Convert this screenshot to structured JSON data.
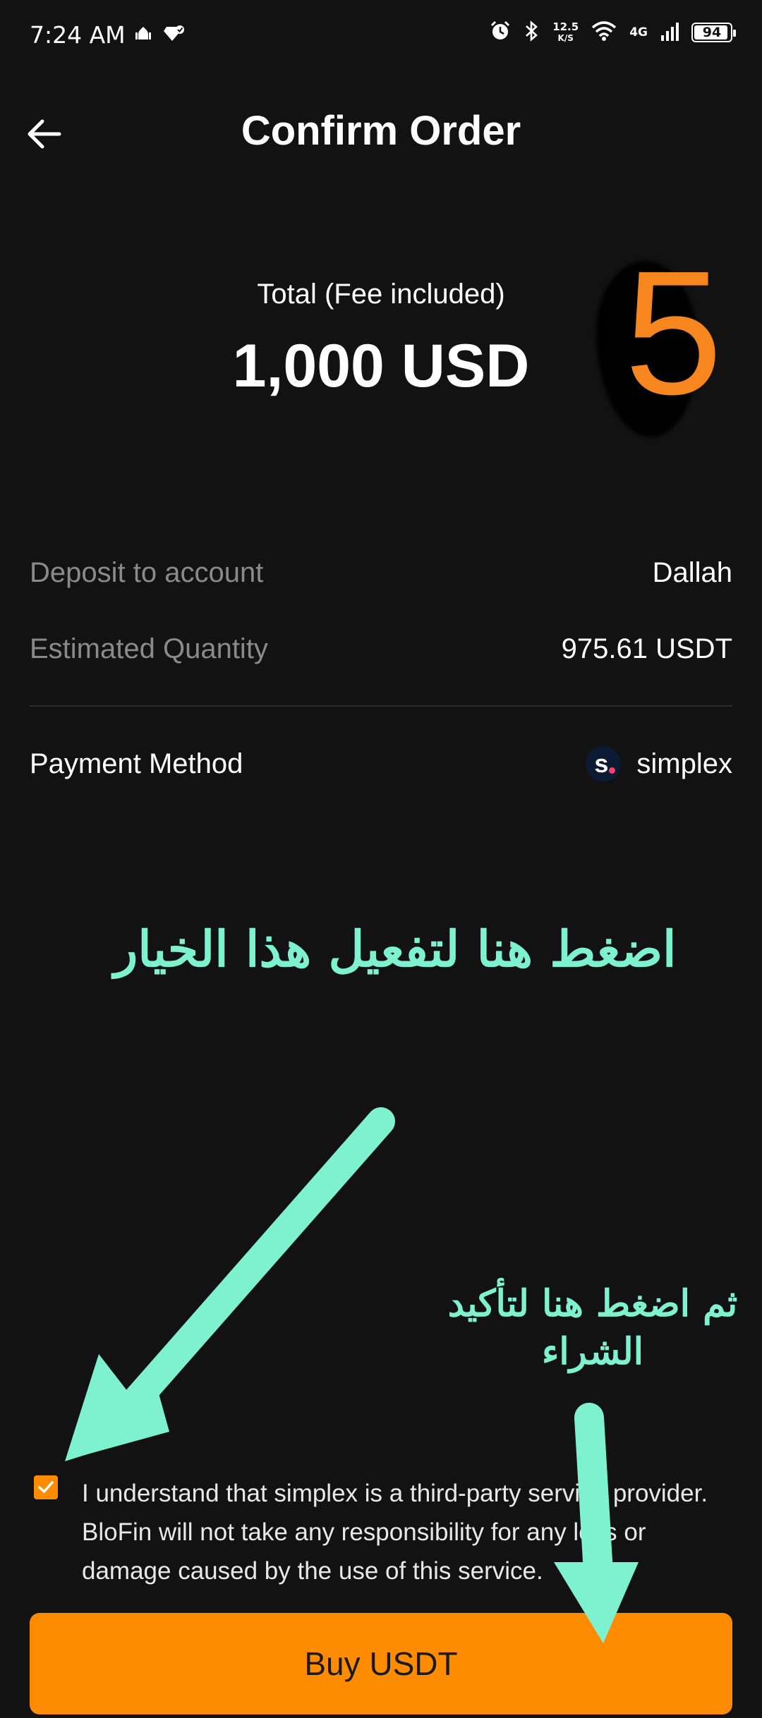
{
  "status_bar": {
    "time": "7:24 AM",
    "net_speed_value": "12.5",
    "net_speed_unit": "K/S",
    "network_type": "4G",
    "battery_percent": "94",
    "battery_level": 0.94
  },
  "header": {
    "title": "Confirm Order"
  },
  "summary": {
    "total_label": "Total (Fee included)",
    "total_amount": "1,000 USD"
  },
  "step_badge": {
    "number": "5",
    "color": "#f7861e"
  },
  "details": {
    "deposit_label": "Deposit to account",
    "deposit_value": "Dallah",
    "quantity_label": "Estimated Quantity",
    "quantity_value": "975.61 USDT",
    "payment_label": "Payment Method",
    "payment_value": "simplex",
    "payment_logo_letter": "s"
  },
  "annotations": {
    "instruction_1": "اضغط هنا لتفعيل هذا الخيار",
    "instruction_2": "ثم اضغط هنا لتأكيد الشراء",
    "color": "#7ef2cf"
  },
  "consent": {
    "checked": true,
    "text": "I understand that simplex is a third-party service provider. BloFin will not take any responsibility for any loss or damage caused by the use of this service."
  },
  "actions": {
    "buy_label": "Buy USDT",
    "accent_color": "#ff8c00"
  }
}
